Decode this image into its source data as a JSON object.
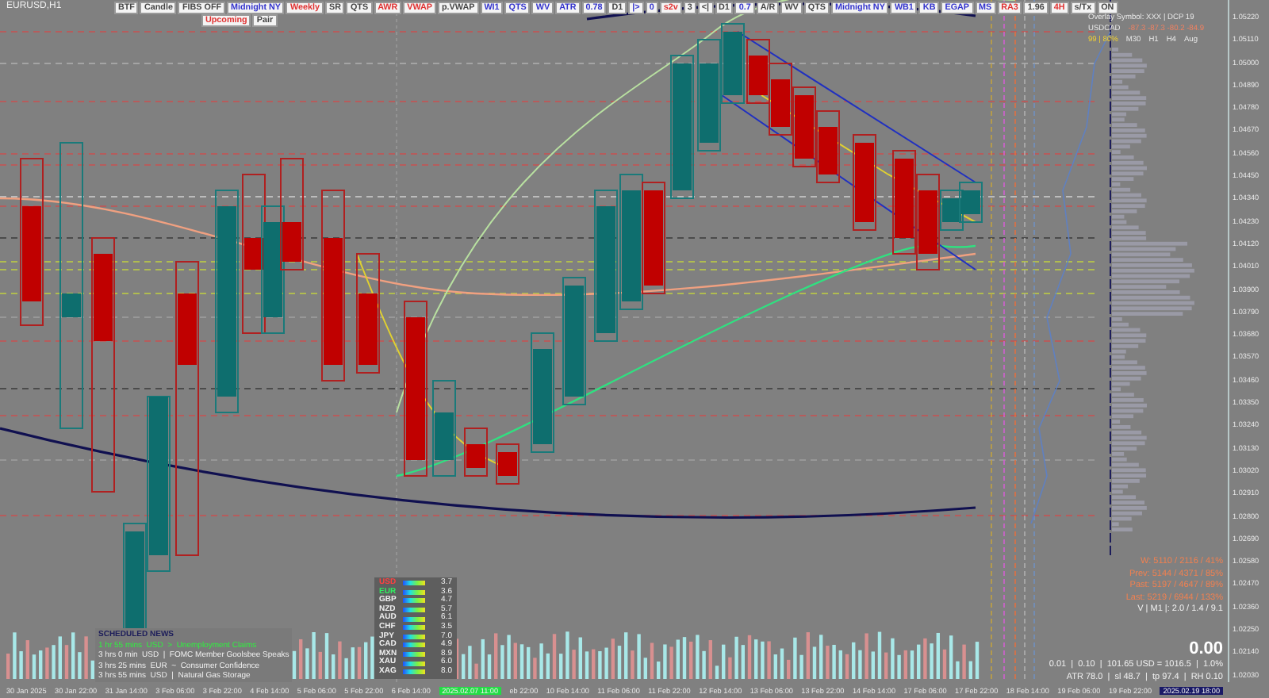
{
  "symbol": "EURUSD,H1",
  "toolbar": [
    {
      "label": "BTF",
      "color": "#444444"
    },
    {
      "label": "Candle",
      "color": "#444444"
    },
    {
      "label": "FIBS OFF",
      "color": "#444444"
    },
    {
      "label": "Midnight NY",
      "color": "#3333cc"
    },
    {
      "label": "Weekly",
      "color": "#e03030"
    },
    {
      "label": "SR",
      "color": "#444444"
    },
    {
      "label": "QTS",
      "color": "#444444"
    },
    {
      "label": "AWR",
      "color": "#e03030"
    },
    {
      "label": "VWAP",
      "color": "#e03030"
    },
    {
      "label": "p.VWAP",
      "color": "#444444"
    },
    {
      "label": "WI1",
      "color": "#3333cc"
    },
    {
      "label": "QTS",
      "color": "#3333cc"
    },
    {
      "label": "WV",
      "color": "#3333cc"
    },
    {
      "label": "ATR",
      "color": "#3333cc"
    },
    {
      "label": "0.78",
      "color": "#3333cc"
    },
    {
      "label": "D1",
      "color": "#444444"
    },
    {
      "label": "|>",
      "color": "#3333cc"
    },
    {
      "label": "0",
      "color": "#3333cc"
    },
    {
      "label": "s2v",
      "color": "#e03030"
    },
    {
      "label": "3",
      "color": "#444444"
    },
    {
      "label": "<|",
      "color": "#444444"
    },
    {
      "label": "D1",
      "color": "#444444"
    },
    {
      "label": "0.7",
      "color": "#3333cc"
    },
    {
      "label": "A/R",
      "color": "#444444"
    },
    {
      "label": "WV",
      "color": "#444444"
    },
    {
      "label": "QTS",
      "color": "#444444"
    },
    {
      "label": "Midnight NY",
      "color": "#3333cc"
    },
    {
      "label": "WB1",
      "color": "#3333cc"
    },
    {
      "label": "KB",
      "color": "#3333cc"
    },
    {
      "label": "EGAP",
      "color": "#3333cc"
    },
    {
      "label": "MS",
      "color": "#3333cc"
    },
    {
      "label": "RA3",
      "color": "#e03030"
    },
    {
      "label": "1.96",
      "color": "#444444"
    },
    {
      "label": "4H",
      "color": "#e03030"
    },
    {
      "label": "s/Tx",
      "color": "#444444"
    },
    {
      "label": "ON",
      "color": "#444444"
    }
  ],
  "toolbar_row2": [
    {
      "label": "Upcoming",
      "color": "#e03030"
    },
    {
      "label": "Pair",
      "color": "#444444"
    }
  ],
  "overlay_panel": {
    "title": "Overlay Symbol: XXX | DCP 19",
    "pair": "USDCAD",
    "values": "-87.3 -87.3 -80.2 -84.9",
    "ratio": "99 | 80%",
    "timeframes": [
      "M30",
      "H1",
      "H4",
      "Aug"
    ]
  },
  "price_axis": [
    "1.05220",
    "1.05110",
    "1.05000",
    "1.04890",
    "1.04780",
    "1.04670",
    "1.04560",
    "1.04450",
    "1.04340",
    "1.04230",
    "1.04120",
    "1.04010",
    "1.03900",
    "1.03790",
    "1.03680",
    "1.03570",
    "1.03460",
    "1.03350",
    "1.03240",
    "1.03130",
    "1.03020",
    "1.02910",
    "1.02800",
    "1.02690",
    "1.02580",
    "1.02470",
    "1.02360",
    "1.02250",
    "1.02140",
    "1.02030"
  ],
  "time_axis": [
    {
      "kind": "label",
      "text": "30 Jan 2025"
    },
    {
      "kind": "label",
      "text": "30 Jan 22:00"
    },
    {
      "kind": "label",
      "text": "31 Jan 14:00"
    },
    {
      "kind": "label",
      "text": "3 Feb 06:00"
    },
    {
      "kind": "label",
      "text": "3 Feb 22:00"
    },
    {
      "kind": "label",
      "text": "4 Feb 14:00"
    },
    {
      "kind": "label",
      "text": "5 Feb 06:00"
    },
    {
      "kind": "label",
      "text": "5 Feb 22:00"
    },
    {
      "kind": "label",
      "text": "6 Feb 14:00"
    },
    {
      "kind": "marker",
      "text": "2025.02.07 11:00",
      "color": "#22dd44"
    },
    {
      "kind": "label",
      "text": "eb 22:00"
    },
    {
      "kind": "label",
      "text": "10 Feb 14:00"
    },
    {
      "kind": "label",
      "text": "11 Feb 06:00"
    },
    {
      "kind": "label",
      "text": "11 Feb 22:00"
    },
    {
      "kind": "label",
      "text": "12 Feb 14:00"
    },
    {
      "kind": "label",
      "text": "13 Feb 06:00"
    },
    {
      "kind": "label",
      "text": "13 Feb 22:00"
    },
    {
      "kind": "label",
      "text": "14 Feb 14:00"
    },
    {
      "kind": "label",
      "text": "17 Feb 06:00"
    },
    {
      "kind": "label",
      "text": "17 Feb 22:00"
    },
    {
      "kind": "label",
      "text": "18 Feb 14:00"
    },
    {
      "kind": "label",
      "text": "19 Feb 06:00"
    },
    {
      "kind": "label",
      "text": "19 Feb 22:00"
    },
    {
      "kind": "marker",
      "text": "2025.02.19 18:00",
      "color": "#1a1a66"
    }
  ],
  "news": {
    "title": "SCHEDULED NEWS",
    "items": [
      {
        "text": "1 hr 55 mins  USD  >  Unemployment Claims",
        "upcoming": true
      },
      {
        "text": "3 hrs 0 min  USD  |  FOMC Member Goolsbee Speaks",
        "upcoming": false
      },
      {
        "text": "3 hrs 25 mins  EUR  ~  Consumer Confidence",
        "upcoming": false
      },
      {
        "text": "3 hrs 55 mins  USD  |  Natural Gas Storage",
        "upcoming": false
      }
    ]
  },
  "strength": [
    {
      "code": "USD",
      "value": "3.7",
      "color": "#ff4040"
    },
    {
      "code": "EUR",
      "value": "3.6",
      "color": "#30f060"
    },
    {
      "code": "GBP",
      "value": "4.7",
      "color": "#f0f0f0"
    },
    {
      "code": "NZD",
      "value": "5.7",
      "color": "#f0f0f0"
    },
    {
      "code": "AUD",
      "value": "6.1",
      "color": "#f0f0f0"
    },
    {
      "code": "CHF",
      "value": "3.5",
      "color": "#f0f0f0"
    },
    {
      "code": "JPY",
      "value": "7.0",
      "color": "#f0f0f0"
    },
    {
      "code": "CAD",
      "value": "4.9",
      "color": "#f0f0f0"
    },
    {
      "code": "MXN",
      "value": "8.9",
      "color": "#f0f0f0"
    },
    {
      "code": "XAU",
      "value": "6.0",
      "color": "#f0f0f0"
    },
    {
      "code": "XAG",
      "value": "8.0",
      "color": "#f0f0f0"
    }
  ],
  "range_stats": [
    "W: 5110 / 2116 / 41%",
    "Prev: 5144 / 4371 / 85%",
    "Past: 5197 / 4647 / 89%",
    "Last: 5219 / 6944 / 133%"
  ],
  "volume_stat": "V | M1 |: 2.0 / 1.4 / 9.1",
  "pnl": "0.00",
  "risk_line": "0.01  |  0.10  |  101.65 USD = 1016.5  |  1.0%",
  "atr_line": "ATR 78.0  |  sl 48.7  |  tp 97.4  |  RH 0.10"
}
